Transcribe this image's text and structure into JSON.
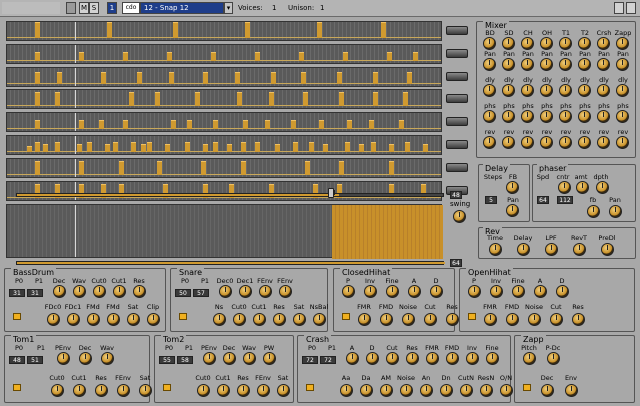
{
  "topbar": {
    "title": "",
    "m_label": "M",
    "s_label": "S",
    "channel": "1",
    "mode": "cdo",
    "preset": "12 - Snap 12",
    "voices_label": "Voices:",
    "voices": "1",
    "unison_label": "Unison:",
    "unison": "1"
  },
  "colors": {
    "accent": "#d09a30",
    "bg": "#a8a8a8"
  },
  "sequencer": {
    "tracks": [
      [
        0,
        0,
        0,
        0,
        0,
        0,
        0,
        0,
        0,
        0,
        0,
        0,
        0,
        0,
        0,
        0,
        0,
        0,
        0,
        0,
        0,
        0,
        0,
        0,
        0,
        0,
        0,
        0,
        0,
        0,
        0,
        0,
        0,
        0,
        0,
        0,
        0,
        0,
        0,
        0,
        0,
        0,
        0,
        0,
        0,
        0,
        0,
        0,
        0,
        0,
        0,
        0,
        0,
        0,
        0,
        0,
        0,
        0,
        0,
        0,
        0,
        0,
        0,
        0,
        0,
        0,
        0,
        0,
        0,
        0,
        0,
        0,
        0,
        0,
        0,
        0,
        0,
        0,
        0,
        0,
        0,
        0,
        0,
        0,
        0,
        0,
        0,
        0,
        0,
        0,
        0,
        0,
        0,
        0,
        0,
        0,
        0,
        0,
        0,
        0,
        0,
        0,
        0,
        0,
        0,
        0,
        0,
        0,
        0
      ],
      [
        0,
        0,
        0,
        0,
        0,
        0,
        0,
        0,
        0,
        0,
        0,
        0,
        0,
        0,
        0,
        0,
        0,
        0,
        0,
        0,
        0,
        0,
        0,
        0,
        0,
        0,
        0,
        0,
        0,
        0,
        0,
        0,
        0,
        0,
        0,
        0,
        0,
        0,
        0,
        0,
        0,
        0,
        0,
        0,
        0,
        0,
        0,
        0,
        0,
        0,
        0,
        0,
        0,
        0,
        0,
        0,
        0,
        0,
        0,
        0,
        0,
        0,
        0,
        0,
        0,
        0,
        0,
        0,
        0,
        0,
        0,
        0,
        0,
        0,
        0,
        0,
        0,
        0,
        0,
        0,
        0,
        0,
        0,
        0,
        0,
        0,
        0,
        0,
        0,
        0,
        0,
        0,
        0,
        0,
        0,
        0,
        0,
        0,
        0,
        0,
        0,
        0,
        0,
        0,
        0,
        0,
        0,
        0,
        0
      ],
      [
        0,
        0,
        0,
        0,
        0,
        0,
        0,
        0,
        0,
        0,
        0,
        0,
        0,
        0,
        0,
        0,
        0,
        0,
        0,
        0,
        0,
        0,
        0,
        0,
        0,
        0,
        0,
        0,
        0,
        0,
        0,
        0,
        0,
        0,
        0,
        0,
        0,
        0,
        0,
        0,
        0,
        0,
        0,
        0,
        0,
        0,
        0,
        0,
        0,
        0,
        0,
        0,
        0,
        0,
        0,
        0,
        0,
        0,
        0,
        0,
        0,
        0,
        0,
        0,
        0,
        0,
        0,
        0,
        0,
        0,
        0,
        0,
        0,
        0,
        0,
        0,
        0,
        0,
        0,
        0,
        0,
        0,
        0,
        0,
        0,
        0,
        0,
        0,
        0,
        0,
        0,
        0,
        0,
        0,
        0,
        0,
        0,
        0,
        0,
        0,
        0,
        0,
        0,
        0,
        0,
        0,
        0,
        0,
        0
      ],
      [
        0,
        0,
        0,
        0,
        0,
        0,
        0,
        0,
        0,
        0,
        0,
        0,
        0,
        0,
        0,
        0,
        0,
        0,
        0,
        0,
        0,
        0,
        0,
        0,
        0,
        0,
        0,
        0,
        0,
        0,
        0,
        0,
        0,
        0,
        0,
        0,
        0,
        0,
        0,
        0,
        0,
        0,
        0,
        0,
        0,
        0,
        0,
        0,
        0,
        0,
        0,
        0,
        0,
        0,
        0,
        0,
        0,
        0,
        0,
        0,
        0,
        0,
        0,
        0,
        0,
        0,
        0,
        0,
        0,
        0,
        0,
        0,
        0,
        0,
        0,
        0,
        0,
        0,
        0,
        0,
        0,
        0,
        0,
        0,
        0,
        0,
        0,
        0,
        0,
        0,
        0,
        0,
        0,
        0,
        0,
        0,
        0,
        0,
        0,
        0,
        0,
        0,
        0,
        0,
        0,
        0,
        0,
        0,
        0
      ],
      [
        0,
        0,
        0,
        0,
        0,
        0,
        0,
        0,
        0,
        0,
        0,
        0,
        0,
        0,
        0,
        0,
        0,
        0,
        0,
        0,
        0,
        0,
        0,
        0,
        0,
        0,
        0,
        0,
        0,
        0,
        0,
        0,
        0,
        0,
        0,
        0,
        0,
        0,
        0,
        0,
        0,
        0,
        0,
        0,
        0,
        0,
        0,
        0,
        0,
        0,
        0,
        0,
        0,
        0,
        0,
        0,
        0,
        0,
        0,
        0,
        0,
        0,
        0,
        0,
        0,
        0,
        0,
        0,
        0,
        0,
        0,
        0,
        0,
        0,
        0,
        0,
        0,
        0,
        0,
        0,
        0,
        0,
        0,
        0,
        0,
        0,
        0,
        0,
        0,
        0,
        0,
        0,
        0,
        0,
        0,
        0,
        0,
        0,
        0,
        0,
        0,
        0,
        0,
        0,
        0,
        0,
        0,
        0,
        0
      ],
      [
        0,
        0,
        0,
        0,
        0,
        0,
        0,
        0,
        0,
        0,
        0,
        0,
        0,
        0,
        0,
        0,
        0,
        0,
        0,
        0,
        0,
        0,
        0,
        0,
        0,
        0,
        0,
        0,
        0,
        0,
        0,
        0,
        0,
        0,
        0,
        0,
        0,
        0,
        0,
        0,
        0,
        0,
        0,
        0,
        0,
        0,
        0,
        0,
        0,
        0,
        0,
        0,
        0,
        0,
        0,
        0,
        0,
        0,
        0,
        0,
        0,
        0,
        0,
        0,
        0,
        0,
        0,
        0,
        0,
        0,
        0,
        0,
        0,
        0,
        0,
        0,
        0,
        0,
        0,
        0,
        0,
        0,
        0,
        0,
        0,
        0,
        0,
        0,
        0,
        0,
        0,
        0,
        0,
        0,
        0,
        0,
        0,
        0,
        0,
        0,
        0,
        0,
        0,
        0,
        0,
        0,
        0,
        0,
        0
      ],
      [
        0,
        0,
        0,
        0,
        0,
        0,
        0,
        0,
        0,
        0,
        0,
        0,
        0,
        0,
        0,
        0,
        0,
        0,
        0,
        0,
        0,
        0,
        0,
        0,
        0,
        0,
        0,
        0,
        0,
        0,
        0,
        0,
        0,
        0,
        0,
        0,
        0,
        0,
        0,
        0,
        0,
        0,
        0,
        0,
        0,
        0,
        0,
        0,
        0,
        0,
        0,
        0,
        0,
        0,
        0,
        0,
        0,
        0,
        0,
        0,
        0,
        0,
        0,
        0,
        0,
        0,
        0,
        0,
        0,
        0,
        0,
        0,
        0,
        0,
        0,
        0,
        0,
        0,
        0,
        0,
        0,
        0,
        0,
        0,
        0,
        0,
        0,
        0,
        0,
        0,
        0,
        0,
        0,
        0,
        0,
        0,
        0,
        0,
        0,
        0,
        0,
        0,
        0,
        0,
        0,
        0,
        0,
        0,
        0
      ],
      [
        0,
        0,
        0,
        0,
        0,
        0,
        0,
        0,
        0,
        0,
        0,
        0,
        0,
        0,
        0,
        0,
        0,
        0,
        0,
        0,
        0,
        0,
        0,
        0,
        0,
        0,
        0,
        0,
        0,
        0,
        0,
        0,
        0,
        0,
        0,
        0,
        0,
        0,
        0,
        0,
        0,
        0,
        0,
        0,
        0,
        0,
        0,
        0,
        0,
        0,
        0,
        0,
        0,
        0,
        0,
        0,
        0,
        0,
        0,
        0,
        0,
        0,
        0,
        0,
        0,
        0,
        0,
        0,
        0,
        0,
        0,
        0,
        0,
        0,
        0,
        0,
        0,
        0,
        0,
        0,
        0,
        0,
        0,
        0,
        0,
        0,
        0,
        0,
        0,
        0,
        0,
        0,
        0,
        0,
        0,
        0,
        0,
        0,
        0,
        0,
        0,
        0,
        0,
        0,
        0,
        0,
        0,
        0,
        0
      ]
    ],
    "len_value": "48",
    "swing_label": "swing",
    "pattern_value": "64"
  },
  "mixer": {
    "title": "Mixer",
    "channels": [
      "BD",
      "SD",
      "CH",
      "OH",
      "T1",
      "T2",
      "Crsh",
      "Zapp"
    ],
    "rows": [
      "Pan",
      "dly",
      "phs",
      "rev"
    ]
  },
  "delay": {
    "title": "Delay",
    "steps_label": "Steps",
    "fb_label": "FB",
    "steps": "5",
    "pan_label": "Pan"
  },
  "phaser": {
    "title": "phaser",
    "spd_label": "Spd",
    "cntr_label": "cntr",
    "amt_label": "amt",
    "dpth_label": "dpth",
    "spd": "64",
    "cntr": "112",
    "fb_label": "fb",
    "pan_label": "Pan"
  },
  "rev": {
    "title": "Rev",
    "labels": [
      "Time",
      "Delay",
      "LPF",
      "RevT",
      "PreDl"
    ]
  },
  "bassdrum": {
    "title": "BassDrum",
    "row1": [
      "P0",
      "P1",
      "Dec",
      "Wav",
      "Cut0",
      "Cut1",
      "Res"
    ],
    "v1": "31",
    "v2": "31",
    "row2": [
      "FDc0",
      "FDc1",
      "FMd",
      "FMd",
      "Sat",
      "Clip"
    ]
  },
  "snare": {
    "title": "Snare",
    "row1": [
      "P0",
      "P1",
      "Dec0",
      "Dec1",
      "FEnv",
      "FEnv"
    ],
    "v1": "50",
    "v2": "57",
    "row2": [
      "Ns",
      "Cut0",
      "Cut1",
      "Res",
      "Sat",
      "NsBal"
    ]
  },
  "closedhihat": {
    "title": "ClosedHihat",
    "row1": [
      "P",
      "Inv",
      "Fine",
      "A",
      "D"
    ],
    "row2": [
      "FMR",
      "FMD",
      "Noise",
      "Cut",
      "Res"
    ]
  },
  "openhihat": {
    "title": "OpenHihat",
    "row1": [
      "P",
      "Inv",
      "Fine",
      "A",
      "D"
    ],
    "row2": [
      "FMR",
      "FMD",
      "Noise",
      "Cut",
      "Res"
    ]
  },
  "tom1": {
    "title": "Tom1",
    "row1": [
      "P0",
      "P1",
      "PEnv",
      "Dec",
      "Wav"
    ],
    "v1": "48",
    "v2": "51",
    "row2": [
      "Cut0",
      "Cut1",
      "Res",
      "FEnv",
      "Sat"
    ]
  },
  "tom2": {
    "title": "Tom2",
    "row1": [
      "P0",
      "P1",
      "PEnv",
      "Dec",
      "Wav",
      "PW"
    ],
    "v1": "55",
    "v2": "58",
    "row2": [
      "Cut0",
      "Cut1",
      "Res",
      "FEnv",
      "Sat"
    ]
  },
  "crash": {
    "title": "Crash",
    "row1": [
      "P0",
      "P1",
      "A",
      "D",
      "Cut",
      "Res",
      "FMR",
      "FMD",
      "Inv",
      "Fine"
    ],
    "v1": "72",
    "v2": "72",
    "row2": [
      "Aa",
      "Da",
      "AM",
      "Noise",
      "An",
      "Dn",
      "CutN",
      "ResN",
      "O/N"
    ]
  },
  "zapp": {
    "title": "Zapp",
    "row1": [
      "Pitch",
      "P-Dc"
    ],
    "row2": [
      "Dec",
      "Env"
    ]
  }
}
